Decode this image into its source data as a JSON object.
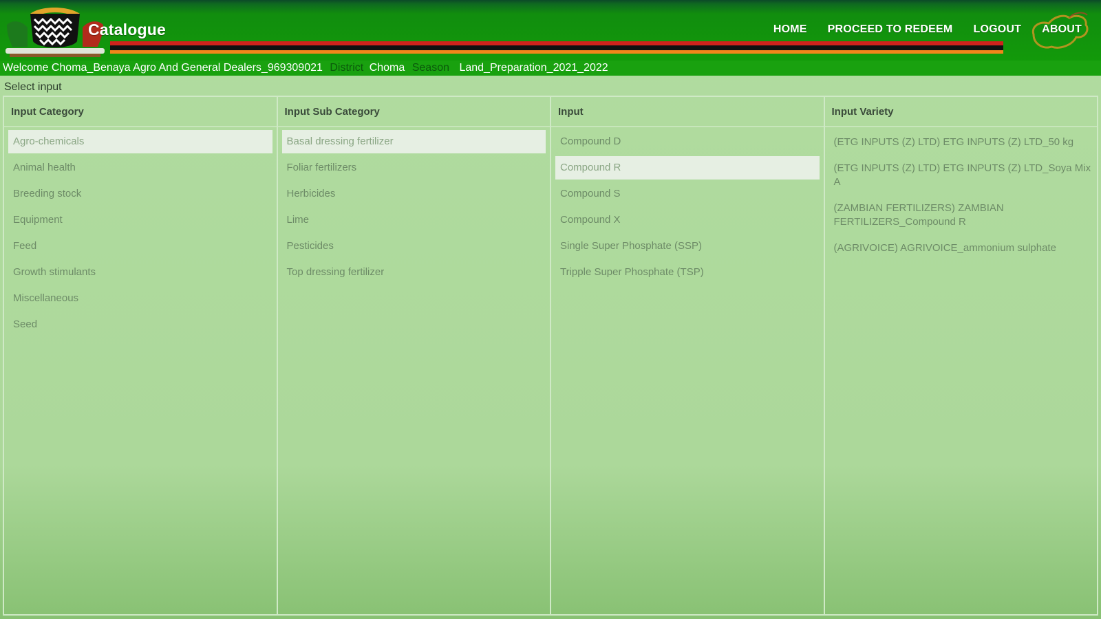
{
  "header": {
    "brand": "Catalogue",
    "nav": [
      "HOME",
      "PROCEED TO REDEEM",
      "LOGOUT",
      "ABOUT"
    ]
  },
  "welcome": {
    "text": "Welcome Choma_Benaya Agro And General Dealers_969309021",
    "district_label": "District",
    "district_value": "Choma",
    "season_label": "Season",
    "season_value": "Land_Preparation_2021_2022"
  },
  "page": {
    "select_title": "Select input"
  },
  "columns": {
    "category": {
      "title": "Input Category",
      "items": [
        "Agro-chemicals",
        "Animal health",
        "Breeding stock",
        "Equipment",
        "Feed",
        "Growth stimulants",
        "Miscellaneous",
        "Seed"
      ],
      "selected_index": 0
    },
    "subcategory": {
      "title": "Input Sub Category",
      "items": [
        "Basal dressing fertilizer",
        "Foliar fertilizers",
        "Herbicides",
        "Lime",
        "Pesticides",
        "Top dressing fertilizer"
      ],
      "selected_index": 0
    },
    "input": {
      "title": "Input",
      "items": [
        "Compound D",
        "Compound R",
        "Compound S",
        "Compound X",
        "Single Super Phosphate (SSP)",
        "Tripple Super Phosphate (TSP)"
      ],
      "selected_index": 1
    },
    "variety": {
      "title": "Input Variety",
      "items": [
        "(ETG INPUTS (Z) LTD) ETG INPUTS (Z) LTD_50 kg",
        "(ETG INPUTS (Z) LTD) ETG INPUTS (Z) LTD_Soya Mix A",
        "(ZAMBIAN FERTILIZERS) ZAMBIAN FERTILIZERS_Compound R",
        "(AGRIVOICE) AGRIVOICE_ammonium sulphate"
      ]
    }
  },
  "colors": {
    "header_green": "#129a0a",
    "welcome_green": "#19a10f",
    "flag_red": "#d0231c",
    "flag_black": "#111111",
    "flag_orange": "#f0861a"
  },
  "icons": [
    "coat-of-arms-logo",
    "zambia-map-icon"
  ]
}
